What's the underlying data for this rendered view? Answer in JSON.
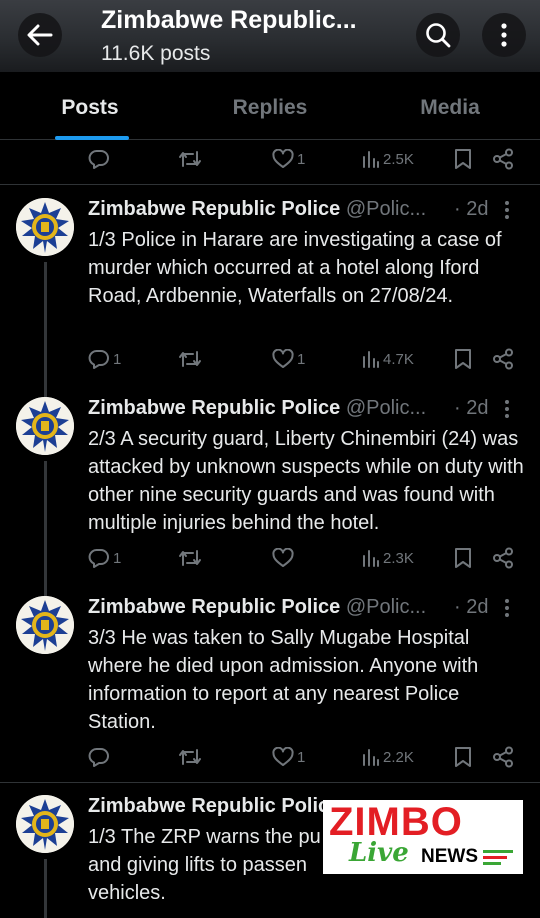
{
  "header": {
    "title": "Zimbabwe Republic...",
    "posts_count": "11.6K posts"
  },
  "tabs": [
    {
      "label": "Posts",
      "active": true
    },
    {
      "label": "Replies",
      "active": false
    },
    {
      "label": "Media",
      "active": false
    }
  ],
  "top_actions": {
    "reply": "",
    "repost": "",
    "like": "1",
    "views": "2.5K"
  },
  "posts": [
    {
      "name": "Zimbabwe Republic Police",
      "handle": "@Polic...",
      "time": "· 2d",
      "text": "1/3 Police in Harare are investigating a case of murder which occurred at a hotel along Iford Road, Ardbennie, Waterfalls on 27/08/24.",
      "reply": "1",
      "repost": "",
      "like": "1",
      "views": "4.7K"
    },
    {
      "name": "Zimbabwe Republic Police",
      "handle": "@Polic...",
      "time": "· 2d",
      "text": "2/3 A security guard, Liberty Chinembiri (24) was attacked by unknown suspects while on duty with other nine security guards and was found with multiple injuries behind the hotel.",
      "reply": "1",
      "repost": "",
      "like": "",
      "views": "2.3K"
    },
    {
      "name": "Zimbabwe Republic Police",
      "handle": "@Polic...",
      "time": "· 2d",
      "text": "3/3 He was taken to Sally Mugabe Hospital where he died upon admission. Anyone with information to report at any nearest Police Station.",
      "reply": "",
      "repost": "",
      "like": "1",
      "views": "2.2K"
    },
    {
      "name": "Zimbabwe Republic Police",
      "handle": "",
      "time": "",
      "text": "1/3 The ZRP warns the pu and giving lifts to passen vehicles.",
      "reply": "",
      "repost": "",
      "like": "",
      "views": ""
    }
  ],
  "watermark": {
    "brand": "ZIMBO",
    "live": "Live",
    "news": "NEWS"
  },
  "colors": {
    "accent": "#1d9bf0",
    "background": "#000000",
    "text": "#e7e9ea",
    "muted": "#71767b",
    "watermark_red": "#e31e24",
    "watermark_green": "#3aa635"
  }
}
